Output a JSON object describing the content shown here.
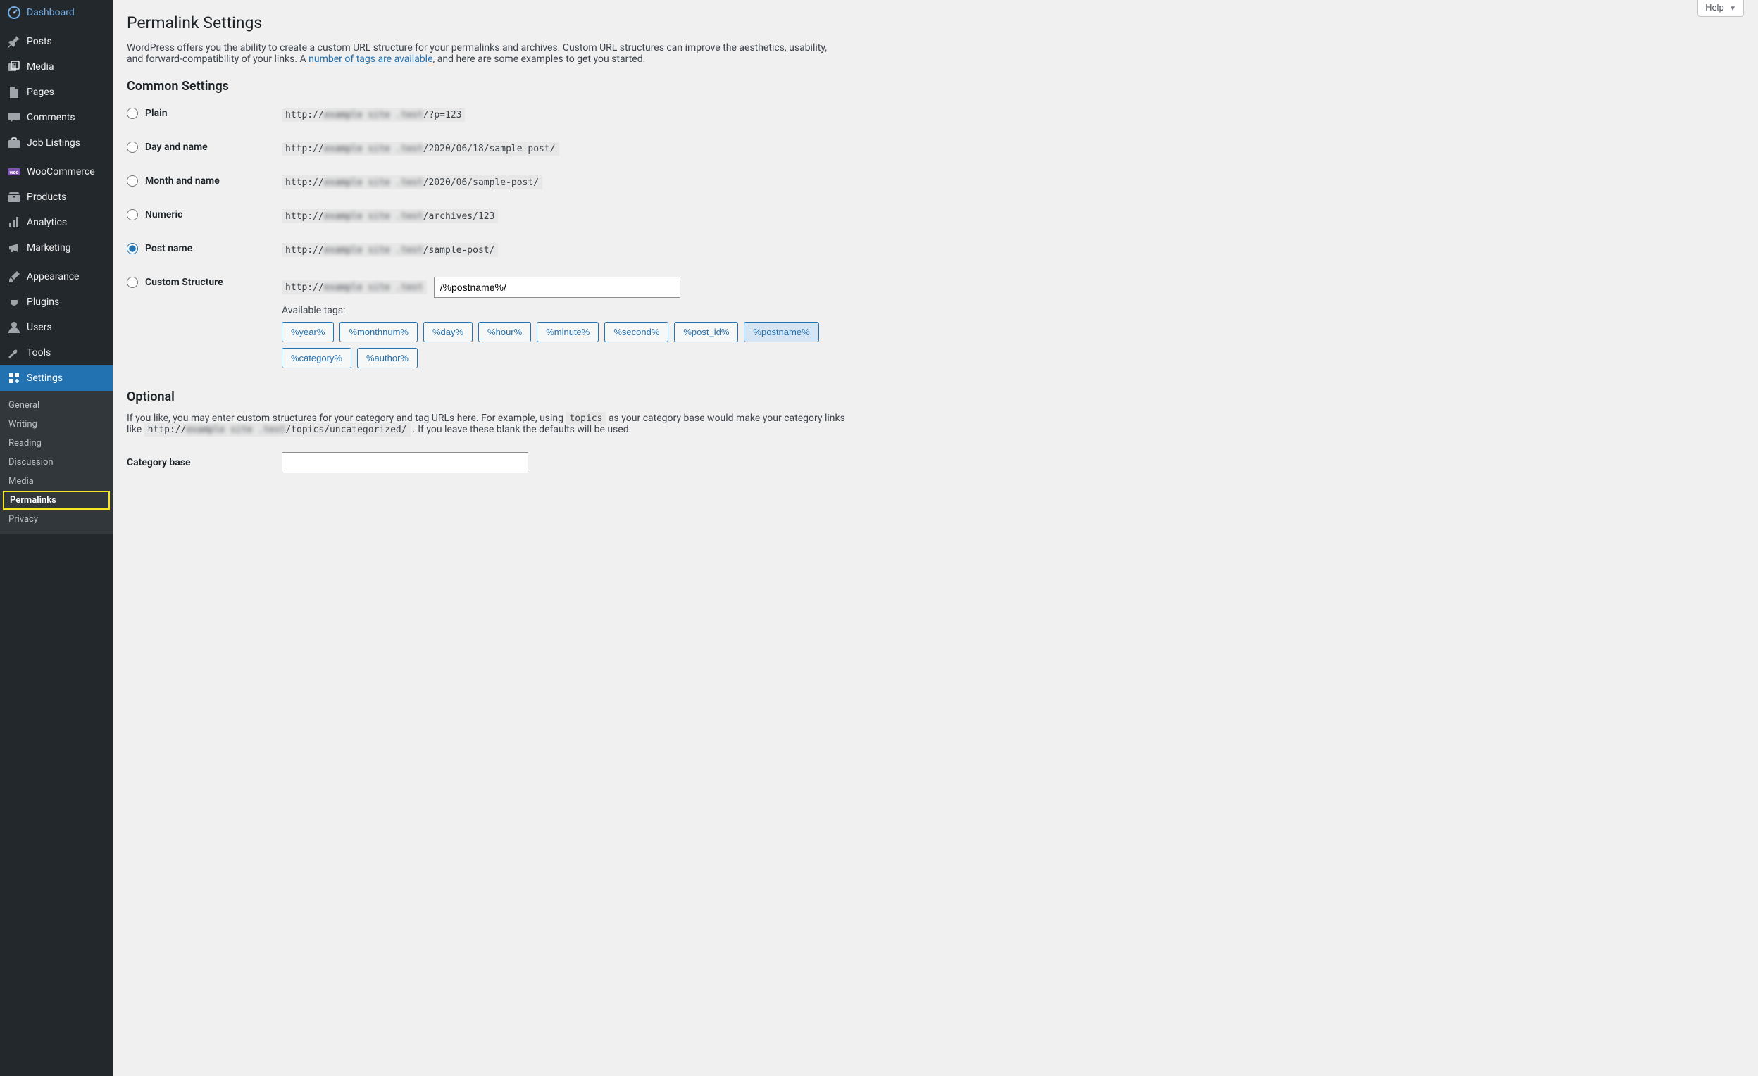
{
  "sidebar": {
    "items": [
      {
        "label": "Dashboard",
        "icon": "dashboard"
      },
      {
        "label": "Posts",
        "icon": "pin"
      },
      {
        "label": "Media",
        "icon": "media"
      },
      {
        "label": "Pages",
        "icon": "page"
      },
      {
        "label": "Comments",
        "icon": "comment"
      },
      {
        "label": "Job Listings",
        "icon": "briefcase"
      },
      {
        "label": "WooCommerce",
        "icon": "woo"
      },
      {
        "label": "Products",
        "icon": "archive"
      },
      {
        "label": "Analytics",
        "icon": "chart"
      },
      {
        "label": "Marketing",
        "icon": "megaphone"
      },
      {
        "label": "Appearance",
        "icon": "brush"
      },
      {
        "label": "Plugins",
        "icon": "plug"
      },
      {
        "label": "Users",
        "icon": "user"
      },
      {
        "label": "Tools",
        "icon": "wrench"
      },
      {
        "label": "Settings",
        "icon": "settings"
      }
    ],
    "submenu": [
      {
        "label": "General"
      },
      {
        "label": "Writing"
      },
      {
        "label": "Reading"
      },
      {
        "label": "Discussion"
      },
      {
        "label": "Media"
      },
      {
        "label": "Permalinks",
        "active": true
      },
      {
        "label": "Privacy"
      }
    ]
  },
  "help": {
    "label": "Help"
  },
  "page": {
    "title": "Permalink Settings",
    "intro_pre": "WordPress offers you the ability to create a custom URL structure for your permalinks and archives. Custom URL structures can improve the aesthetics, usability, and forward-compatibility of your links. A ",
    "intro_link": "number of tags are available",
    "intro_post": ", and here are some examples to get you started.",
    "h_common": "Common Settings",
    "h_optional": "Optional",
    "optional_pre": "If you like, you may enter custom structures for your category and tag URLs here. For example, using ",
    "optional_code1": "topics",
    "optional_mid": " as your category base would make your category links like ",
    "optional_code2_pre": "http://",
    "optional_code2_blur": "example site .test",
    "optional_code2_post": "/topics/uncategorized/",
    "optional_end": " . If you leave these blank the defaults will be used.",
    "category_base_label": "Category base"
  },
  "structures": {
    "domain_blur": "example site .test",
    "options": [
      {
        "key": "plain",
        "label": "Plain",
        "suffix": "/?p=123"
      },
      {
        "key": "dayname",
        "label": "Day and name",
        "suffix": "/2020/06/18/sample-post/"
      },
      {
        "key": "monthname",
        "label": "Month and name",
        "suffix": "/2020/06/sample-post/"
      },
      {
        "key": "numeric",
        "label": "Numeric",
        "suffix": "/archives/123"
      },
      {
        "key": "postname",
        "label": "Post name",
        "suffix": "/sample-post/",
        "selected": true
      },
      {
        "key": "custom",
        "label": "Custom Structure",
        "custom": true
      }
    ],
    "custom_value": "/%postname%/",
    "available_label": "Available tags:",
    "tags": [
      {
        "t": "%year%"
      },
      {
        "t": "%monthnum%"
      },
      {
        "t": "%day%"
      },
      {
        "t": "%hour%"
      },
      {
        "t": "%minute%"
      },
      {
        "t": "%second%"
      },
      {
        "t": "%post_id%"
      },
      {
        "t": "%postname%",
        "active": true
      },
      {
        "t": "%category%"
      },
      {
        "t": "%author%"
      }
    ]
  }
}
